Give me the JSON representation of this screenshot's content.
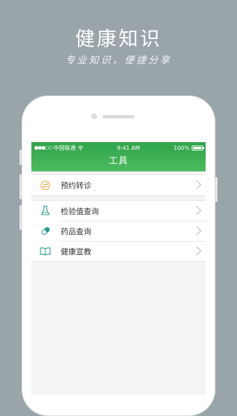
{
  "promo": {
    "title": "健康知识",
    "subtitle": "专业知识，便捷分享"
  },
  "status_bar": {
    "carrier": "中国联通",
    "time": "9:41 AM",
    "battery": "100%"
  },
  "nav": {
    "title": "工具"
  },
  "groups": [
    {
      "items": [
        {
          "label": "预约转诊",
          "icon": "transfer-icon"
        }
      ]
    },
    {
      "items": [
        {
          "label": "检验值查询",
          "icon": "flask-icon"
        },
        {
          "label": "药品查询",
          "icon": "pill-icon"
        },
        {
          "label": "健康宣教",
          "icon": "book-icon"
        }
      ]
    }
  ],
  "colors": {
    "background": "#9aa5aa",
    "header_green": "#3cae52",
    "transfer_icon": "#e5a63a",
    "teal_icon": "#2a9a8f"
  }
}
